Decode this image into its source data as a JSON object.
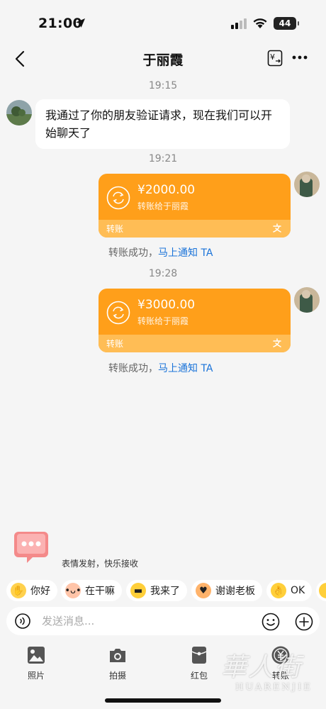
{
  "status_bar": {
    "time": "21:00",
    "battery": "44"
  },
  "header": {
    "title": "于丽霞",
    "transfer_icon_glyph": "¥"
  },
  "messages": {
    "ts1": "19:15",
    "greeting": "我通过了你的朋友验证请求，现在我们可以开始聊天了",
    "ts2": "19:21",
    "transfer1": {
      "amount": "¥2000.00",
      "desc": "转账给于丽霞",
      "label": "转账"
    },
    "status1": {
      "text": "转账成功，",
      "link": "马上通知 TA"
    },
    "ts3": "19:28",
    "transfer2": {
      "amount": "¥3000.00",
      "desc": "转账给于丽霞",
      "label": "转账"
    },
    "status2": {
      "text": "转账成功，",
      "link": "马上通知 TA"
    }
  },
  "emoji_panel": {
    "caption": "表情发射，快乐接收",
    "chips": [
      "你好",
      "在干嘛",
      "我来了",
      "谢谢老板",
      "OK"
    ]
  },
  "input": {
    "placeholder": "发送消息..."
  },
  "toolbar": {
    "items": [
      "照片",
      "拍摄",
      "红包",
      "转账"
    ]
  },
  "watermark": {
    "big": "華人街",
    "small": "HUARENJIE"
  },
  "colors": {
    "transfer_orange": "#ff9f1a",
    "link_blue": "#1a73d9",
    "background": "#f5f5f5"
  },
  "icons": [
    "location-arrow-icon",
    "signal-icon",
    "wifi-icon",
    "back-icon",
    "transfer-icon",
    "more-icon",
    "exchange-icon",
    "alipay-icon",
    "voice-icon",
    "emoji-icon",
    "plus-icon",
    "photo-icon",
    "camera-icon",
    "red-packet-icon",
    "transfer-coin-icon"
  ]
}
